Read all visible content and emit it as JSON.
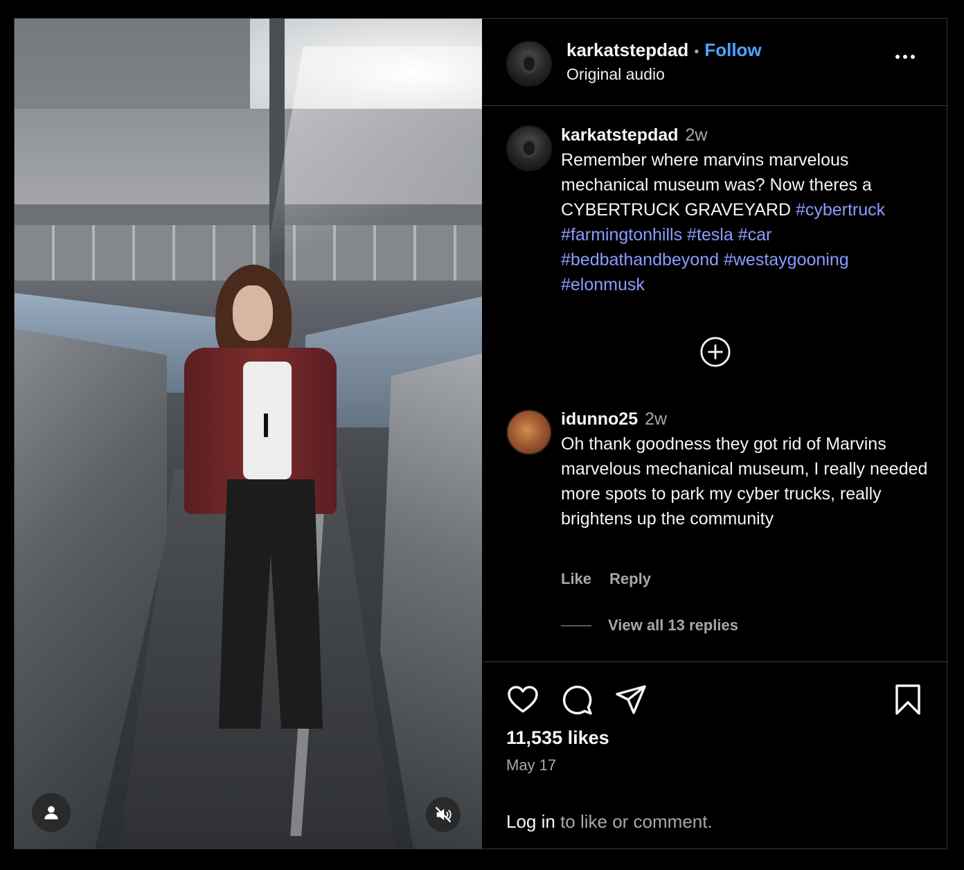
{
  "post": {
    "username": "karkatstepdad",
    "separator": "•",
    "follow_label": "Follow",
    "audio_label": "Original audio"
  },
  "caption": {
    "username": "karkatstepdad",
    "time": "2w",
    "text": "Remember where marvins marvelous mechanical museum was? Now theres a CYBERTRUCK GRAVEYARD ",
    "hashtags": [
      "#cybertruck",
      "#farmingtonhills",
      "#tesla",
      "#car",
      "#bedbathandbeyond",
      "#westaygooning",
      "#elonmusk"
    ]
  },
  "comment": {
    "username": "idunno25",
    "time": "2w",
    "text": "Oh thank goodness they got rid of Marvins marvelous mechanical museum, I really needed more spots to park my cyber trucks, really brightens up the community",
    "like_label": "Like",
    "reply_label": "Reply",
    "view_replies_label": "View all 13 replies"
  },
  "footer": {
    "likes": "11,535 likes",
    "date": "May 17",
    "login_label": "Log in",
    "login_suffix": " to like or comment."
  },
  "icons": {
    "more": "more-options-icon",
    "load_more": "plus-circle-icon",
    "like": "heart-icon",
    "comment": "comment-icon",
    "share": "share-icon",
    "save": "bookmark-icon",
    "user_tag": "user-tag-icon",
    "mute": "muted-audio-icon"
  },
  "colors": {
    "background": "#000000",
    "accent_follow": "#4fa3ff",
    "hashtag": "#8b9cff",
    "secondary_text": "#a8a8a8"
  }
}
